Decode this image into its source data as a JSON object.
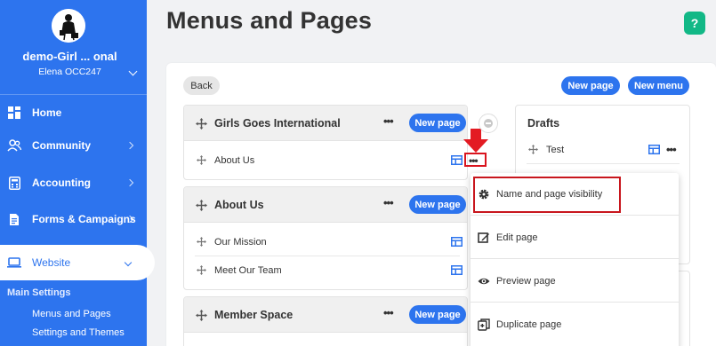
{
  "sidebar": {
    "org_name": "demo-Girl ...  onal",
    "user": "Elena OCC247",
    "items": [
      {
        "label": "Home"
      },
      {
        "label": "Community"
      },
      {
        "label": "Accounting"
      },
      {
        "label": "Forms & Campaigns"
      },
      {
        "label": "Website"
      }
    ],
    "sub_title": "Main Settings",
    "sub_items": [
      "Menus and Pages",
      "Settings and Themes"
    ]
  },
  "header": {
    "title": "Menus and Pages",
    "help": "?"
  },
  "toolbar": {
    "back": "Back",
    "new_page": "New page",
    "new_menu": "New menu"
  },
  "menus": [
    {
      "title": "Girls Goes International",
      "new_page": "New page",
      "pages": [
        "About Us"
      ]
    },
    {
      "title": "About Us",
      "new_page": "New page",
      "pages": [
        "Our Mission",
        "Meet Our Team"
      ]
    },
    {
      "title": "Member Space",
      "new_page": "New page",
      "pages": []
    }
  ],
  "drafts": {
    "title": "Drafts",
    "pages": [
      "Test"
    ]
  },
  "dropdown": {
    "items": [
      {
        "label": "Name and page visibility",
        "icon": "gear-icon"
      },
      {
        "label": "Edit page",
        "icon": "edit-icon"
      },
      {
        "label": "Preview page",
        "icon": "eye-icon"
      },
      {
        "label": "Duplicate page",
        "icon": "duplicate-icon"
      }
    ]
  },
  "colors": {
    "sidebar_blue": "#2d74ee",
    "accent_blue": "#2d74ee",
    "help_green": "#12b886",
    "highlight_red": "#d9141e"
  }
}
